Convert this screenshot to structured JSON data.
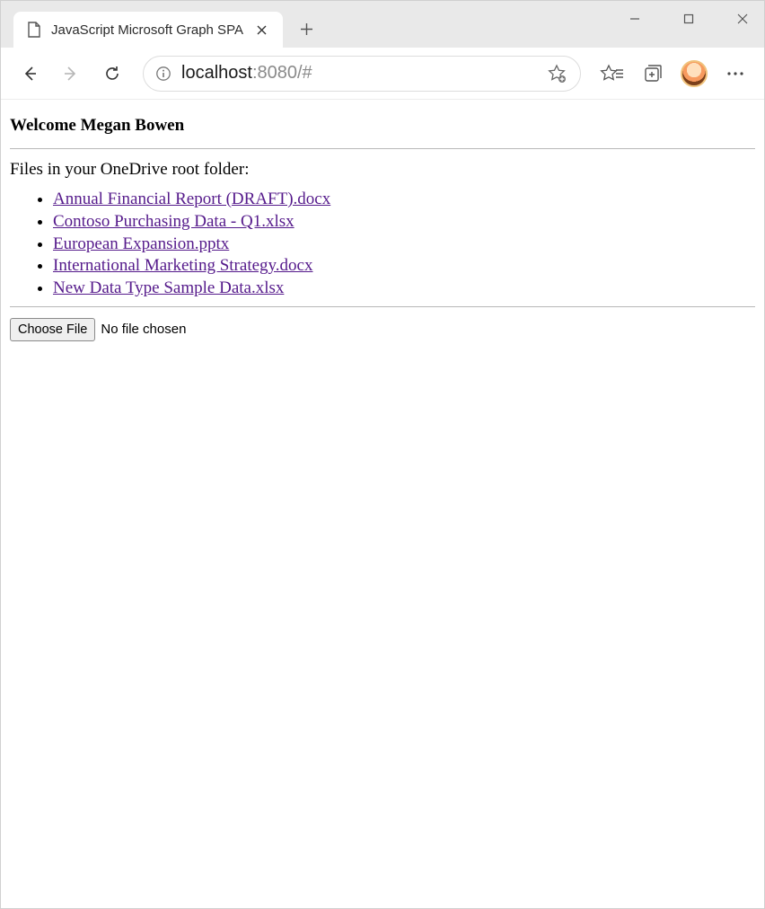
{
  "browser": {
    "tab_title": "JavaScript Microsoft Graph SPA",
    "url_host": "localhost",
    "url_rest": ":8080/#"
  },
  "page": {
    "welcome": "Welcome Megan Bowen",
    "files_heading": "Files in your OneDrive root folder:",
    "files": [
      "Annual Financial Report (DRAFT).docx",
      "Contoso Purchasing Data - Q1.xlsx",
      "European Expansion.pptx",
      "International Marketing Strategy.docx",
      "New Data Type Sample Data.xlsx"
    ],
    "choose_file_label": "Choose File",
    "no_file_label": "No file chosen"
  }
}
